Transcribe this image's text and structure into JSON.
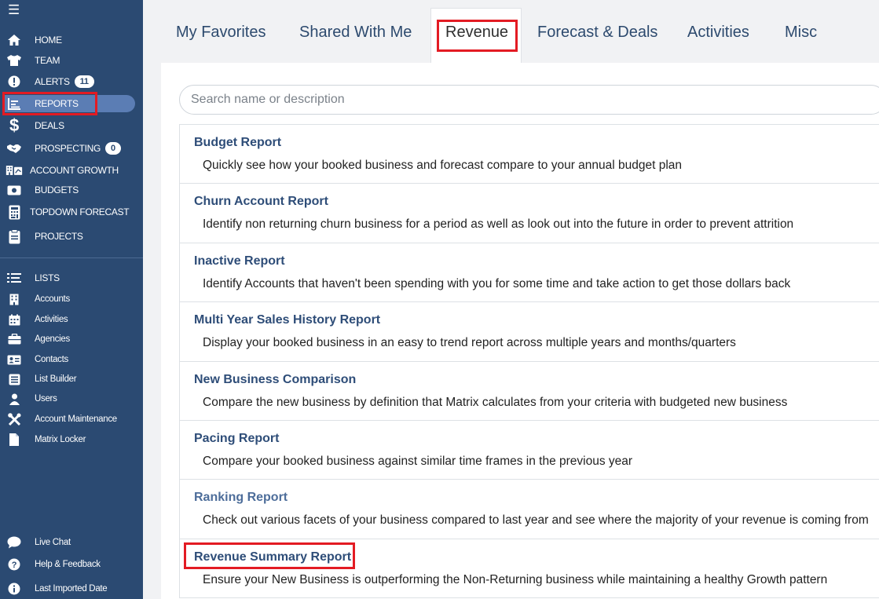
{
  "sidebar": {
    "menu_icon": "hamburger-icon",
    "items": [
      {
        "label": "HOME",
        "icon": "home-icon"
      },
      {
        "label": "TEAM",
        "icon": "shirt-icon"
      },
      {
        "label": "ALERTS",
        "icon": "alert-icon",
        "badge": "11"
      },
      {
        "label": "REPORTS",
        "icon": "chart-icon"
      },
      {
        "label": "DEALS",
        "icon": "dollar-icon"
      },
      {
        "label": "PROSPECTING",
        "icon": "handshake-icon",
        "badge": "0"
      },
      {
        "label": "ACCOUNT GROWTH",
        "icon": "building-icon"
      },
      {
        "label": "BUDGETS",
        "icon": "money-icon"
      },
      {
        "label": "TOPDOWN FORECAST",
        "icon": "calculator-icon"
      },
      {
        "label": "PROJECTS",
        "icon": "clipboard-icon"
      }
    ],
    "lists_header": "LISTS",
    "list_items": [
      {
        "label": "Accounts",
        "icon": "building-icon"
      },
      {
        "label": "Activities",
        "icon": "calendar-icon"
      },
      {
        "label": "Agencies",
        "icon": "briefcase-icon"
      },
      {
        "label": "Contacts",
        "icon": "contact-card-icon"
      },
      {
        "label": "List Builder",
        "icon": "list-builder-icon"
      },
      {
        "label": "Users",
        "icon": "user-icon"
      },
      {
        "label": "Account Maintenance",
        "icon": "tools-icon"
      },
      {
        "label": "Matrix Locker",
        "icon": "file-icon"
      }
    ],
    "footer_items": [
      {
        "label": "Live Chat",
        "icon": "chat-icon"
      },
      {
        "label": "Help & Feedback",
        "icon": "question-icon"
      },
      {
        "label": "Last Imported Date",
        "icon": "info-icon"
      }
    ],
    "active_color": "#5b7db4",
    "bg_color": "#2b4a72"
  },
  "tabs": [
    {
      "label": "My Favorites"
    },
    {
      "label": "Shared With Me"
    },
    {
      "label": "Revenue",
      "active": true
    },
    {
      "label": "Forecast & Deals"
    },
    {
      "label": "Activities"
    },
    {
      "label": "Misc"
    }
  ],
  "search": {
    "placeholder": "Search name or description",
    "value": ""
  },
  "reports": [
    {
      "title": "Budget Report",
      "description": "Quickly see how your booked business and forecast compare to your annual budget plan"
    },
    {
      "title": "Churn Account Report",
      "description": "Identify non returning churn business for a period as well as look out into the future in order to prevent attrition"
    },
    {
      "title": "Inactive Report",
      "description": "Identify Accounts that haven't been spending with you for some time and take action to get those dollars back"
    },
    {
      "title": "Multi Year Sales History Report",
      "description": "Display your booked business in an easy to trend report across multiple years and months/quarters"
    },
    {
      "title": "New Business Comparison",
      "description": "Compare the new business by definition that Matrix calculates from your criteria with budgeted new business"
    },
    {
      "title": "Pacing Report",
      "description": "Compare your booked business against similar time frames in the previous year"
    },
    {
      "title": "Ranking Report",
      "description": "Check out various facets of your business compared to last year and see where the majority of your revenue is coming from"
    },
    {
      "title": "Revenue Summary Report",
      "description": "Ensure your New Business is outperforming the Non-Returning business while maintaining a healthy Growth pattern"
    }
  ],
  "highlight_color": "#e31b23"
}
